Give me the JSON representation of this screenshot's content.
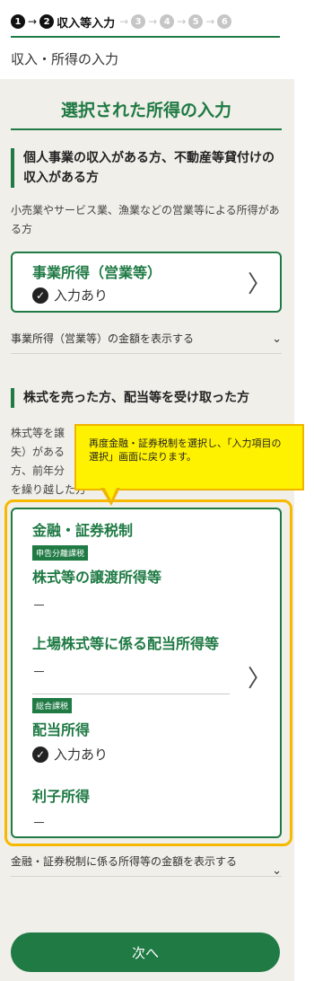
{
  "steps": {
    "s1": "1",
    "s2": "2",
    "s3": "3",
    "s4": "4",
    "s5": "5",
    "s6": "6",
    "current_label": "収入等入力"
  },
  "heading": "収入・所得の入力",
  "panel_title": "選択された所得の入力",
  "business": {
    "section_title": "個人事業の収入がある方、不動産等貸付けの収入がある方",
    "description": "小売業やサービス業、漁業などの営業等による所得がある方",
    "card_title": "事業所得（営業等）",
    "status": "入力あり",
    "toggle": "事業所得（営業等）の金額を表示する"
  },
  "stocks": {
    "section_title": "株式を売った方、配当等を受け取った方",
    "desc_line1": "株式等を譲",
    "desc_line2": "失）がある",
    "desc_line3": "方、前年分",
    "desc_line4": "を繰り越した方",
    "card_title": "金融・証券税制",
    "badge1": "申告分離課税",
    "item1": "株式等の譲渡所得等",
    "item1_value": "－",
    "item2": "上場株式等に係る配当所得等",
    "item2_value": "－",
    "badge2": "総合課税",
    "item3": "配当所得",
    "item3_status": "入力あり",
    "item4": "利子所得",
    "item4_value": "－",
    "toggle": "金融・証券税制に係る所得等の金額を表示する"
  },
  "tooltip": "再度金融・証券税制を選択し、「入力項目の選択」画面に戻ります。",
  "next_button": "次へ",
  "colors": {
    "accent": "#1f7a44",
    "highlight": "#f6b900",
    "tooltip_bg": "#fff200"
  }
}
